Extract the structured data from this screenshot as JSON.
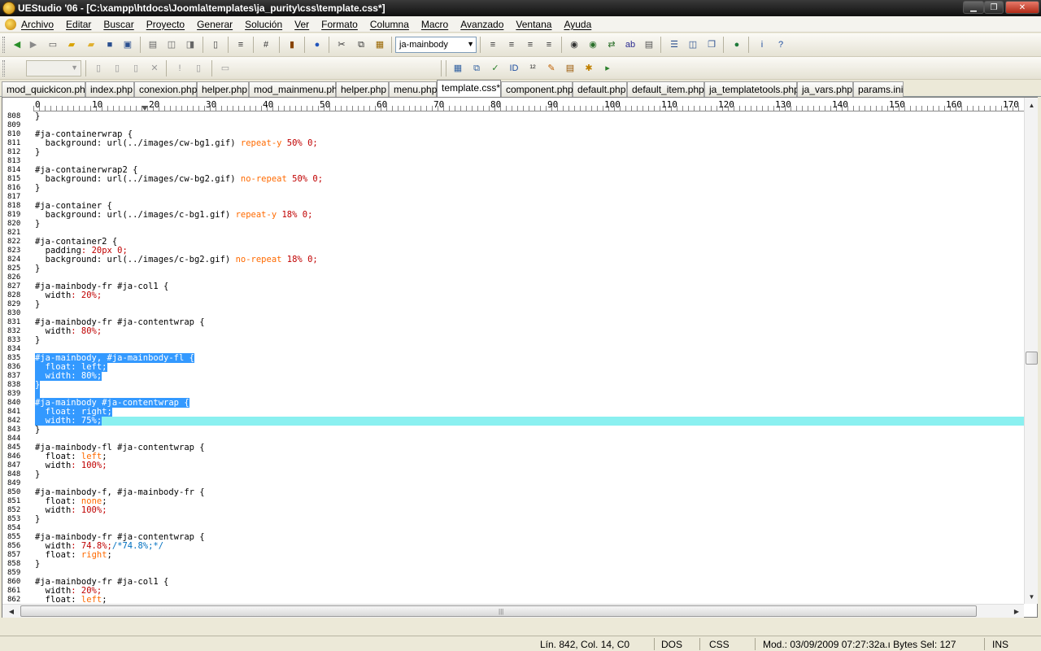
{
  "window": {
    "title": "UEStudio '06 - [C:\\xampp\\htdocs\\Joomla\\templates\\ja_purity\\css\\template.css*]",
    "min_glyph": "▁",
    "max_glyph": "❐",
    "close_glyph": "✕"
  },
  "menu": {
    "items": [
      "Archivo",
      "Editar",
      "Buscar",
      "Proyecto",
      "Generar",
      "Solución",
      "Ver",
      "Formato",
      "Columna",
      "Macro",
      "Avanzado",
      "Ventana",
      "Ayuda"
    ],
    "mdi_min": "_",
    "mdi_restore": "❐",
    "mdi_close": "×"
  },
  "toolbar": {
    "function_combo_value": "ja-mainbody",
    "combo_arrow": "▼"
  },
  "tabs": [
    "mod_quickicon.php",
    "index.php",
    "conexion.php",
    "helper.php",
    "mod_mainmenu.php",
    "helper.php",
    "menu.php",
    "template.css*",
    "component.php",
    "default.php",
    "default_item.php",
    "ja_templatetools.php",
    "ja_vars.php",
    "params.ini"
  ],
  "active_tab_index": 7,
  "ruler": {
    "labels": [
      "0",
      "10",
      "20",
      "30",
      "40",
      "50",
      "60",
      "70",
      "80",
      "90",
      "100",
      "110",
      "120",
      "130",
      "140",
      "150",
      "160",
      "170"
    ]
  },
  "editor": {
    "first_line_number": 808,
    "current_line": 842,
    "lines": [
      [
        [
          "}",
          ""
        ]
      ],
      [],
      [
        [
          "#ja-containerwrap {",
          ""
        ]
      ],
      [
        [
          "  ",
          ""
        ],
        [
          "background",
          ""
        ],
        [
          ": url(../images/cw-bg1.gif) ",
          ""
        ],
        [
          "repeat-y",
          "val"
        ],
        [
          " 50% 0;",
          "kw"
        ]
      ],
      [
        [
          "}",
          ""
        ]
      ],
      [],
      [
        [
          "#ja-containerwrap2 {",
          ""
        ]
      ],
      [
        [
          "  ",
          ""
        ],
        [
          "background",
          ""
        ],
        [
          ": url(../images/cw-bg2.gif) ",
          ""
        ],
        [
          "no-repeat",
          "val"
        ],
        [
          " 50% 0;",
          "kw"
        ]
      ],
      [
        [
          "}",
          ""
        ]
      ],
      [],
      [
        [
          "#ja-container {",
          ""
        ]
      ],
      [
        [
          "  ",
          ""
        ],
        [
          "background",
          ""
        ],
        [
          ": url(../images/c-bg1.gif) ",
          ""
        ],
        [
          "repeat-y",
          "val"
        ],
        [
          " 18% 0;",
          "kw"
        ]
      ],
      [
        [
          "}",
          ""
        ]
      ],
      [],
      [
        [
          "#ja-container2 {",
          ""
        ]
      ],
      [
        [
          "  ",
          ""
        ],
        [
          "padding",
          ""
        ],
        [
          ": 20px 0;",
          "kw"
        ]
      ],
      [
        [
          "  ",
          ""
        ],
        [
          "background",
          ""
        ],
        [
          ": url(../images/c-bg2.gif) ",
          ""
        ],
        [
          "no-repeat",
          "val"
        ],
        [
          " 18% 0;",
          "kw"
        ]
      ],
      [
        [
          "}",
          ""
        ]
      ],
      [],
      [
        [
          "#ja-mainbody-fr #ja-col1 {",
          ""
        ]
      ],
      [
        [
          "  ",
          ""
        ],
        [
          "width",
          ""
        ],
        [
          ": 20%;",
          "kw"
        ]
      ],
      [
        [
          "}",
          ""
        ]
      ],
      [],
      [
        [
          "#ja-mainbody-fr #ja-contentwrap {",
          ""
        ]
      ],
      [
        [
          "  ",
          ""
        ],
        [
          "width",
          ""
        ],
        [
          ": 80%;",
          "kw"
        ]
      ],
      [
        [
          "}",
          ""
        ]
      ],
      [],
      [
        [
          "#ja-mainbody, #ja-mainbody-fl {",
          "sel"
        ]
      ],
      [
        [
          "  float: left;",
          "sel"
        ]
      ],
      [
        [
          "  width: 80%;",
          "sel"
        ]
      ],
      [
        [
          "}",
          "sel"
        ]
      ],
      [
        [
          " ",
          "sel"
        ]
      ],
      [
        [
          "#ja-mainbody #ja-contentwrap {",
          "sel"
        ]
      ],
      [
        [
          "  float: right;",
          "sel"
        ]
      ],
      [
        [
          "  width: 75%;",
          "sel"
        ]
      ],
      [
        [
          "}",
          ""
        ]
      ],
      [],
      [
        [
          "#ja-mainbody-fl #ja-contentwrap {",
          ""
        ]
      ],
      [
        [
          "  ",
          ""
        ],
        [
          "float",
          ""
        ],
        [
          ": ",
          ""
        ],
        [
          "left",
          "val"
        ],
        [
          ";",
          ""
        ]
      ],
      [
        [
          "  ",
          ""
        ],
        [
          "width",
          ""
        ],
        [
          ": 100%;",
          "kw"
        ]
      ],
      [
        [
          "}",
          ""
        ]
      ],
      [],
      [
        [
          "#ja-mainbody-f, #ja-mainbody-fr {",
          ""
        ]
      ],
      [
        [
          "  ",
          ""
        ],
        [
          "float",
          ""
        ],
        [
          ": ",
          ""
        ],
        [
          "none",
          "val"
        ],
        [
          ";",
          ""
        ]
      ],
      [
        [
          "  ",
          ""
        ],
        [
          "width",
          ""
        ],
        [
          ": 100%;",
          "kw"
        ]
      ],
      [
        [
          "}",
          ""
        ]
      ],
      [],
      [
        [
          "#ja-mainbody-fr #ja-contentwrap {",
          ""
        ]
      ],
      [
        [
          "  ",
          ""
        ],
        [
          "width",
          ""
        ],
        [
          ": 74.8%;",
          "kw"
        ],
        [
          "/*74.8%;*/",
          "cmt"
        ]
      ],
      [
        [
          "  ",
          ""
        ],
        [
          "float",
          ""
        ],
        [
          ": ",
          ""
        ],
        [
          "right",
          "val"
        ],
        [
          ";",
          ""
        ]
      ],
      [
        [
          "}",
          ""
        ]
      ],
      [],
      [
        [
          "#ja-mainbody-fr #ja-col1 {",
          ""
        ]
      ],
      [
        [
          "  ",
          ""
        ],
        [
          "width",
          ""
        ],
        [
          ": 20%;",
          "kw"
        ]
      ],
      [
        [
          "  ",
          ""
        ],
        [
          "float",
          ""
        ],
        [
          ": ",
          ""
        ],
        [
          "left",
          "val"
        ],
        [
          ";",
          ""
        ]
      ],
      [
        [
          "}",
          ""
        ]
      ]
    ]
  },
  "scroll": {
    "up": "▲",
    "down": "▼",
    "left": "◀",
    "right": "▶",
    "grip": "|||"
  },
  "status": {
    "position": "Lín. 842, Col. 14, C0",
    "line_ending": "DOS",
    "syntax": "CSS",
    "modified": "Mod.: 03/09/2009 07:27:32a.ı Bytes Sel: 127",
    "insert_mode": "INS"
  },
  "colors": {
    "selection": "#3399ff",
    "current_line": "#8af0f0",
    "property_value": "#c00000",
    "keyword": "#ff6a00",
    "comment": "#0070c0"
  },
  "icons": {
    "toolbar1": [
      "arrow-back-icon",
      "arrow-forward-icon",
      "new-file-icon",
      "open-file-icon",
      "open-folder-icon",
      "save-icon",
      "save-all-icon",
      "print-icon",
      "print-preview-icon",
      "print-setup-icon",
      "document-icon",
      "wrap-icon",
      "hex-icon",
      "bookmark-icon",
      "browser-icon",
      "cut-icon",
      "copy-icon",
      "paste-icon",
      "align-left-icon",
      "align-center-icon",
      "align-right-icon",
      "justify-icon",
      "find-icon",
      "find-next-icon",
      "replace-icon",
      "spell-check-icon",
      "print-file-icon",
      "split-horizontal-icon",
      "split-vertical-icon",
      "cascade-icon",
      "globe-icon",
      "info-icon",
      "help-icon"
    ],
    "toolbar2": [
      "project-icon",
      "project-add-icon",
      "project-settings-icon",
      "project-close-icon",
      "compile-icon",
      "build-icon",
      "output-icon",
      "table-icon",
      "copy-table-icon",
      "check-icon",
      "id-icon",
      "numbers-icon",
      "tools-icon",
      "script-icon",
      "macro-icon",
      "run-macro-icon"
    ]
  }
}
